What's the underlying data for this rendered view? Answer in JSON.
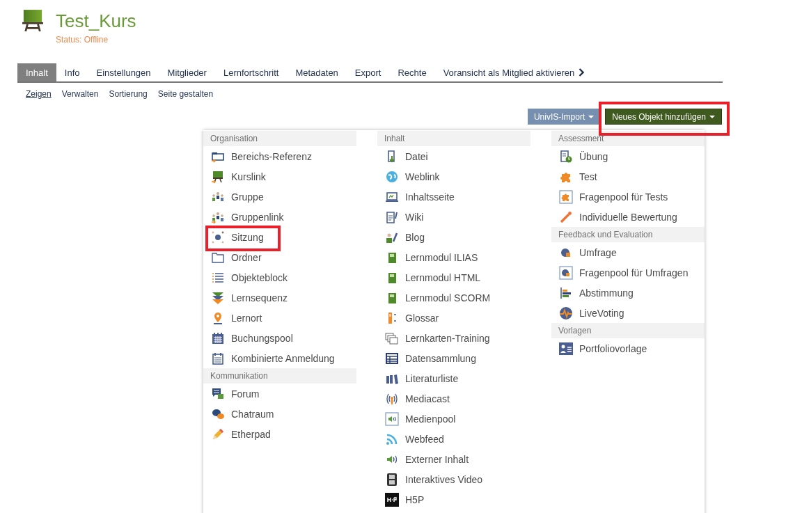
{
  "course": {
    "title": "Test_Kurs",
    "status": "Status: Offline"
  },
  "tabs": [
    {
      "label": "Inhalt",
      "selected": true,
      "kind": "tab"
    },
    {
      "label": "Info",
      "selected": false,
      "kind": "tab"
    },
    {
      "label": "Einstellungen",
      "selected": false,
      "kind": "tab"
    },
    {
      "label": "Mitglieder",
      "selected": false,
      "kind": "tab"
    },
    {
      "label": "Lernfortschritt",
      "selected": false,
      "kind": "tab"
    },
    {
      "label": "Metadaten",
      "selected": false,
      "kind": "tab"
    },
    {
      "label": "Export",
      "selected": false,
      "kind": "tab"
    },
    {
      "label": "Rechte",
      "selected": false,
      "kind": "tab"
    },
    {
      "label": "Voransicht als Mitglied aktivieren",
      "selected": false,
      "kind": "action"
    }
  ],
  "subtabs": [
    {
      "label": "Zeigen",
      "selected": true
    },
    {
      "label": "Verwalten",
      "selected": false
    },
    {
      "label": "Sortierung",
      "selected": false
    },
    {
      "label": "Seite gestalten",
      "selected": false
    }
  ],
  "buttons": [
    {
      "label": "UnivIS-Import",
      "kind": "secondary",
      "highlighted": false
    },
    {
      "label": "Neues Objekt hinzufügen",
      "kind": "primary",
      "highlighted": true
    }
  ],
  "menu": {
    "columns": [
      {
        "groups": [
          {
            "heading": "Organisation",
            "items": [
              {
                "label": "Bereichs-Referenz",
                "highlighted": false
              },
              {
                "label": "Kurslink",
                "highlighted": false
              },
              {
                "label": "Gruppe",
                "highlighted": false
              },
              {
                "label": "Gruppenlink",
                "highlighted": false
              },
              {
                "label": "Sitzung",
                "highlighted": true
              },
              {
                "label": "Ordner",
                "highlighted": false
              },
              {
                "label": "Objekteblock",
                "highlighted": false
              },
              {
                "label": "Lernsequenz",
                "highlighted": false
              },
              {
                "label": "Lernort",
                "highlighted": false
              },
              {
                "label": "Buchungspool",
                "highlighted": false
              },
              {
                "label": "Kombinierte Anmeldung",
                "highlighted": false
              }
            ]
          },
          {
            "heading": "Kommunikation",
            "items": [
              {
                "label": "Forum",
                "highlighted": false
              },
              {
                "label": "Chatraum",
                "highlighted": false
              },
              {
                "label": "Etherpad",
                "highlighted": false
              }
            ]
          }
        ]
      },
      {
        "groups": [
          {
            "heading": "Inhalt",
            "items": [
              {
                "label": "Datei",
                "highlighted": false
              },
              {
                "label": "Weblink",
                "highlighted": false
              },
              {
                "label": "Inhaltsseite",
                "highlighted": false
              },
              {
                "label": "Wiki",
                "highlighted": false
              },
              {
                "label": "Blog",
                "highlighted": false
              },
              {
                "label": "Lernmodul ILIAS",
                "highlighted": false
              },
              {
                "label": "Lernmodul HTML",
                "highlighted": false
              },
              {
                "label": "Lernmodul SCORM",
                "highlighted": false
              },
              {
                "label": "Glossar",
                "highlighted": false
              },
              {
                "label": "Lernkarten-Training",
                "highlighted": false
              },
              {
                "label": "Datensammlung",
                "highlighted": false
              },
              {
                "label": "Literaturliste",
                "highlighted": false
              },
              {
                "label": "Mediacast",
                "highlighted": false
              },
              {
                "label": "Medienpool",
                "highlighted": false
              },
              {
                "label": "Webfeed",
                "highlighted": false
              },
              {
                "label": "Externer Inhalt",
                "highlighted": false
              },
              {
                "label": "Interaktives Video",
                "highlighted": false
              },
              {
                "label": "H5P",
                "highlighted": false
              }
            ]
          }
        ]
      },
      {
        "groups": [
          {
            "heading": "Assessment",
            "items": [
              {
                "label": "Übung",
                "highlighted": false
              },
              {
                "label": "Test",
                "highlighted": false
              },
              {
                "label": "Fragenpool für Tests",
                "highlighted": false
              },
              {
                "label": "Individuelle Bewertung",
                "highlighted": false
              }
            ]
          },
          {
            "heading": "Feedback und Evaluation",
            "items": [
              {
                "label": "Umfrage",
                "highlighted": false
              },
              {
                "label": "Fragenpool für Umfragen",
                "highlighted": false
              },
              {
                "label": "Abstimmung",
                "highlighted": false
              },
              {
                "label": "LiveVoting",
                "highlighted": false
              }
            ]
          },
          {
            "heading": "Vorlagen",
            "items": [
              {
                "label": "Portfoliovorlage",
                "highlighted": false
              }
            ]
          }
        ]
      }
    ]
  }
}
